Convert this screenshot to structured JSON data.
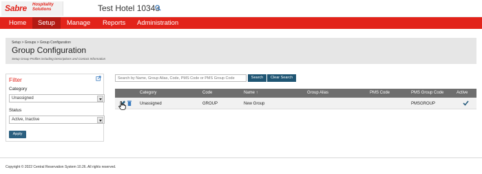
{
  "brand": {
    "logo_name": "Sabre",
    "logo_tagline_line1": "Hospitality",
    "logo_tagline_line2": "Solutions",
    "accent_color": "#e2231a"
  },
  "hotel": {
    "name": "Test Hotel 10343",
    "search_icon": "search-icon"
  },
  "nav": {
    "items": [
      {
        "label": "Home",
        "active": false
      },
      {
        "label": "Setup",
        "active": true
      },
      {
        "label": "Manage",
        "active": false
      },
      {
        "label": "Reports",
        "active": false
      },
      {
        "label": "Administration",
        "active": false
      }
    ]
  },
  "page": {
    "breadcrumb": "Setup > Groups > Group Configuration",
    "title": "Group Configuration",
    "subtitle": "Setup Group Profiles including Descriptions and Contact Information"
  },
  "filter": {
    "title": "Filter",
    "category_label": "Category",
    "category_value": "Unassigned",
    "status_label": "Status",
    "status_value": "Active, Inactive",
    "apply_label": "Apply"
  },
  "search": {
    "placeholder": "Search by Name, Group Alias, Code, PMS Code or PMS Group Code",
    "search_label": "Search",
    "clear_label": "Clear Search"
  },
  "table": {
    "headers": [
      "Category",
      "Code",
      "Name ↑",
      "Group Alias",
      "PMS Code",
      "PMS Group Code",
      "Active"
    ],
    "rows": [
      {
        "category": "Unassigned",
        "code": "GROUP",
        "name": "New Group",
        "group_alias": "",
        "pms_code": "",
        "pms_group_code": "PMSGROUP",
        "active": true
      }
    ]
  },
  "footer": {
    "copyright": "Copyright © 2022 Central Reservation System 10.26. All rights reserved."
  }
}
